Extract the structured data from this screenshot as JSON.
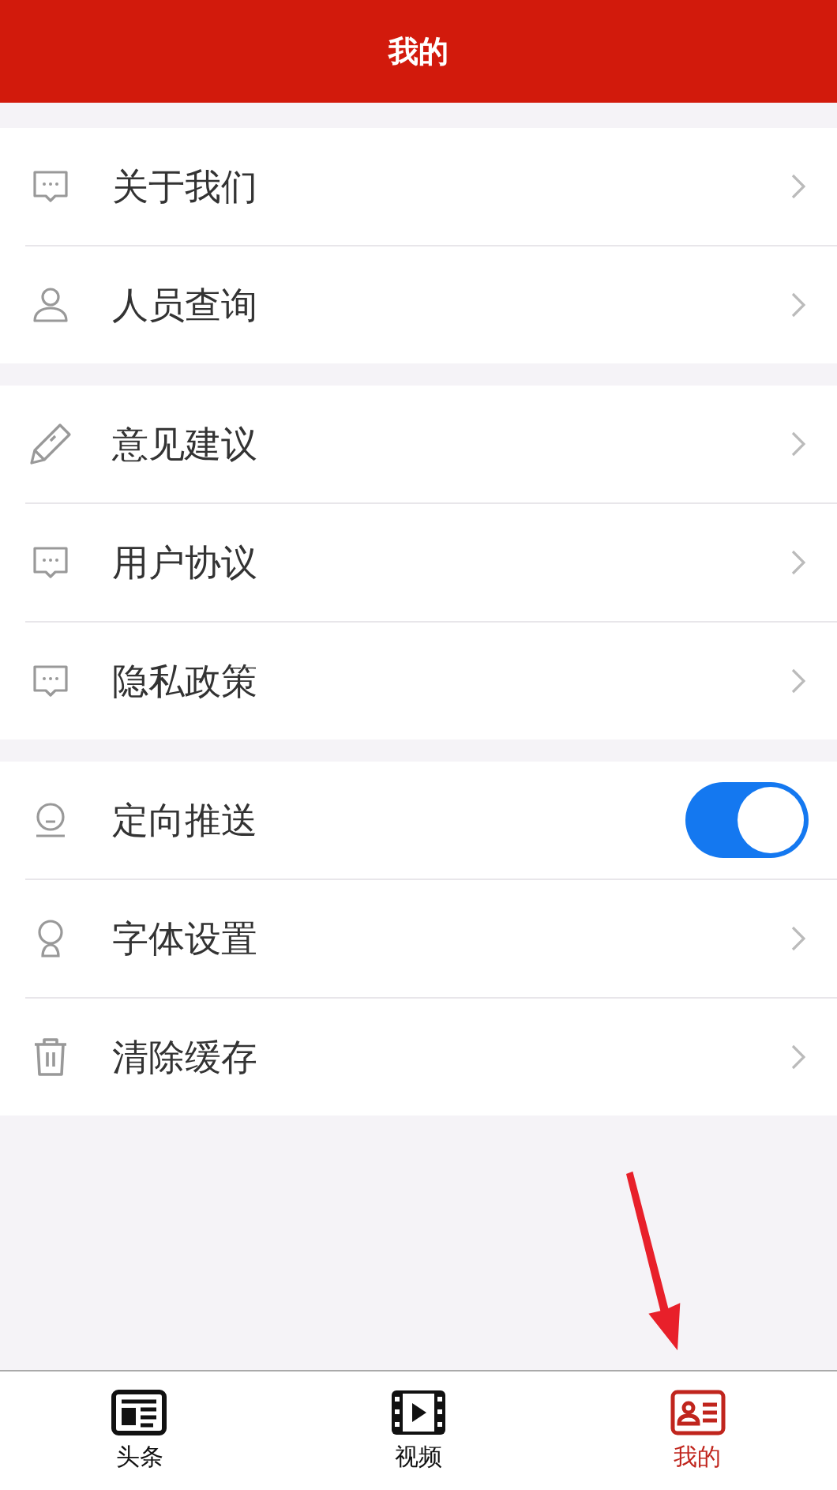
{
  "header": {
    "title": "我的"
  },
  "groups": [
    {
      "rows": [
        {
          "label": "关于我们",
          "kind": "link"
        },
        {
          "label": "人员查询",
          "kind": "link"
        }
      ]
    },
    {
      "rows": [
        {
          "label": "意见建议",
          "kind": "link"
        },
        {
          "label": "用户协议",
          "kind": "link"
        },
        {
          "label": "隐私政策",
          "kind": "link"
        }
      ]
    },
    {
      "rows": [
        {
          "label": "定向推送",
          "kind": "toggle",
          "on": true
        },
        {
          "label": "字体设置",
          "kind": "link"
        },
        {
          "label": "清除缓存",
          "kind": "link"
        }
      ]
    }
  ],
  "tabbar": [
    {
      "label": "头条",
      "selected": false
    },
    {
      "label": "视频",
      "selected": false
    },
    {
      "label": "我的",
      "selected": true
    }
  ]
}
